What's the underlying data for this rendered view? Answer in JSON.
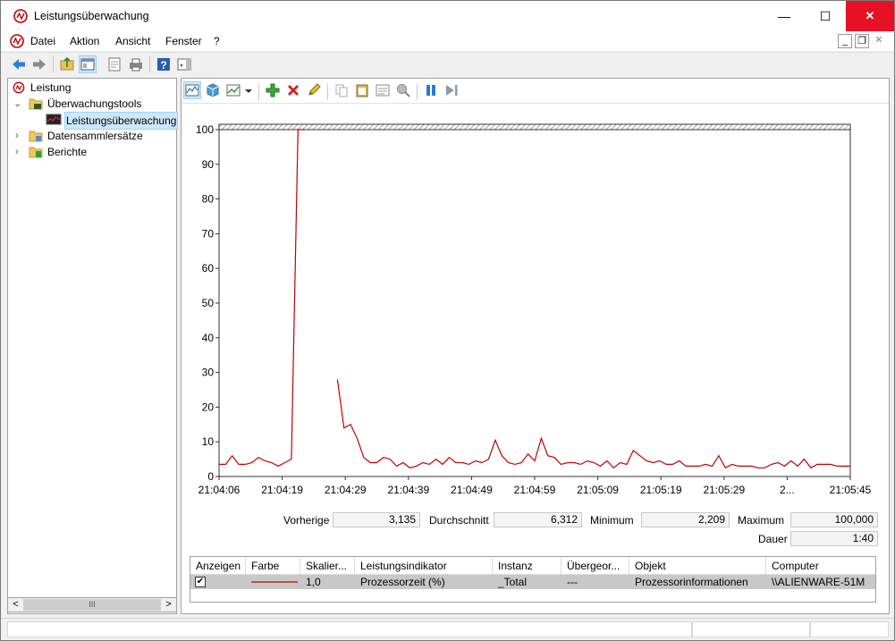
{
  "window": {
    "title": "Leistungsüberwachung",
    "minimize_symbol": "—",
    "maximize_symbol": "☐",
    "close_symbol": "✕"
  },
  "menu": {
    "items": [
      "Datei",
      "Aktion",
      "Ansicht",
      "Fenster",
      "?"
    ],
    "mdi_minimize": "_",
    "mdi_restore": "❐",
    "mdi_close": "✕"
  },
  "tree": {
    "items": [
      {
        "label": "Leistung",
        "icon": "perf-icon"
      },
      {
        "label": "Überwachungstools",
        "icon": "folder-icon",
        "expanded": true
      },
      {
        "label": "Leistungsüberwachung",
        "icon": "monitor-icon",
        "selected": true
      },
      {
        "label": "Datensammlersätze",
        "icon": "folder-icon",
        "expanded": false
      },
      {
        "label": "Berichte",
        "icon": "folder-report-icon",
        "expanded": false
      }
    ],
    "expanded_arrow": "⌄",
    "collapsed_arrow": "›"
  },
  "scrollbar": {
    "left": "<",
    "right": ">",
    "thumb_grip": "III"
  },
  "chart_data": {
    "type": "line",
    "ylim": [
      0,
      100
    ],
    "y_ticks": [
      0,
      10,
      20,
      30,
      40,
      50,
      60,
      70,
      80,
      90,
      100
    ],
    "x_tick_labels": [
      "21:04:06",
      "21:04:19",
      "21:04:29",
      "21:04:39",
      "21:04:49",
      "21:04:59",
      "21:05:09",
      "21:05:19",
      "21:05:29",
      "2...",
      "21:05:45"
    ],
    "grid": false,
    "color": "#c00000",
    "series": [
      {
        "segments": [
          [
            3.5,
            3.5,
            6,
            3.5,
            3.5,
            4,
            5.5,
            4.5,
            4,
            3,
            4,
            5,
            100,
            100
          ],
          [
            28,
            14,
            15,
            11,
            5.5,
            4,
            4,
            5.5,
            5,
            3,
            4,
            2.5,
            3,
            4,
            3.5,
            5,
            3.5,
            5.5,
            4,
            4,
            3.5,
            4.5,
            4,
            5,
            10.5,
            6,
            4,
            3.5,
            4,
            6.5,
            4.5,
            11,
            6,
            5.5,
            3.5,
            4,
            4,
            3.5,
            4.5,
            4,
            3,
            4.5,
            2.5,
            4,
            3.5,
            7.5,
            6,
            4.5,
            4,
            4.5,
            3.5,
            3.5,
            4.5,
            3,
            3,
            3,
            3.5,
            3,
            6,
            2.5,
            3.5,
            3,
            3,
            3,
            2.5,
            2.5,
            3.5,
            4,
            3,
            4.5,
            3,
            5,
            2.5,
            3.5,
            3.5,
            3.5,
            3,
            3,
            3
          ]
        ]
      }
    ]
  },
  "stats": {
    "prev_label": "Vorherige",
    "prev_value": "3,135",
    "avg_label": "Durchschnitt",
    "avg_value": "6,312",
    "min_label": "Minimum",
    "min_value": "2,209",
    "max_label": "Maximum",
    "max_value": "100,000",
    "dur_label": "Dauer",
    "dur_value": "1:40"
  },
  "counters": {
    "headers": [
      "Anzeigen",
      "Farbe",
      "Skalier...",
      "Leistungsindikator",
      "Instanz",
      "Übergeor...",
      "Objekt",
      "Computer"
    ],
    "row": {
      "checked": "✔",
      "scale": "1,0",
      "counter": "Prozessorzeit (%)",
      "instance": "_Total",
      "parent": "---",
      "object": "Prozessorinformationen",
      "computer": "\\\\ALIENWARE-51M"
    }
  }
}
